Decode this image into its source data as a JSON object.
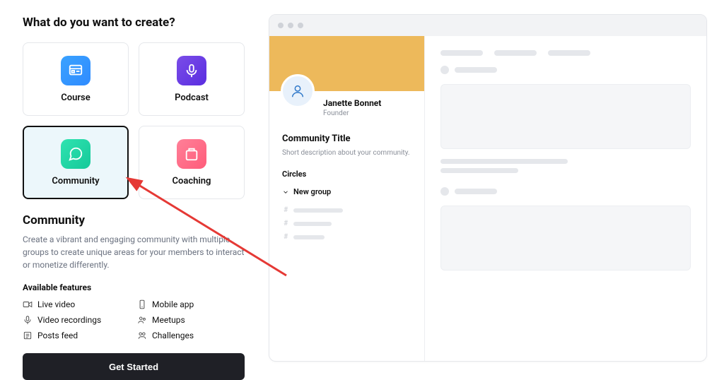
{
  "heading": "What do you want to create?",
  "cards": {
    "course": {
      "label": "Course",
      "icon": "course-icon"
    },
    "podcast": {
      "label": "Podcast",
      "icon": "podcast-icon"
    },
    "community": {
      "label": "Community",
      "icon": "community-icon",
      "selected": true
    },
    "coaching": {
      "label": "Coaching",
      "icon": "coaching-icon"
    }
  },
  "selection": {
    "title": "Community",
    "description": "Create a vibrant and engaging community with multiple groups to create unique areas for your members to interact or monetize differently.",
    "features_heading": "Available features",
    "features": {
      "live_video": "Live video",
      "mobile_app": "Mobile app",
      "video_recordings": "Video recordings",
      "meetups": "Meetups",
      "posts_feed": "Posts feed",
      "challenges": "Challenges"
    },
    "cta": "Get Started"
  },
  "preview": {
    "user": {
      "name": "Janette Bonnet",
      "role": "Founder"
    },
    "community_title": "Community Title",
    "community_desc": "Short description about your community.",
    "circles_label": "Circles",
    "new_group_label": "New group",
    "colors": {
      "banner": "#edb95b",
      "avatar_bg": "#e8f1fb",
      "avatar_stroke": "#2f78c9"
    }
  }
}
